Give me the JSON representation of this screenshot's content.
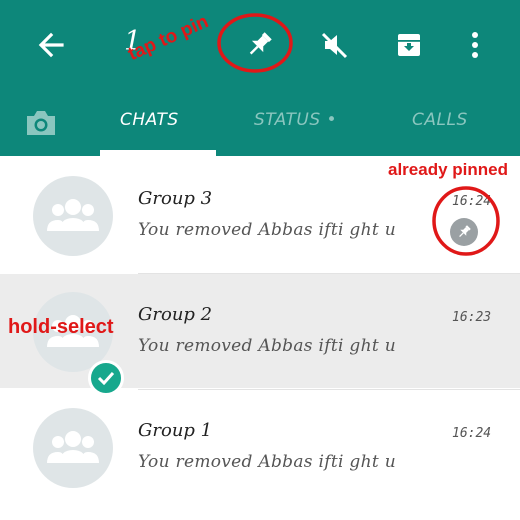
{
  "header": {
    "selected_count": "1",
    "icons": [
      "back-arrow-icon",
      "pin-icon",
      "mute-icon",
      "archive-icon",
      "more-vert-icon"
    ]
  },
  "tabs": [
    {
      "label": "CHATS",
      "active": true
    },
    {
      "label": "STATUS",
      "active": false
    },
    {
      "label": "CALLS",
      "active": false
    }
  ],
  "status_dot": "•",
  "chats": [
    {
      "name": "Group 3",
      "message": "You removed Abbas ifti ght u",
      "time": "16:24",
      "pinned": true,
      "selected": false
    },
    {
      "name": "Group 2",
      "message": "You removed Abbas ifti ght u",
      "time": "16:23",
      "pinned": false,
      "selected": true
    },
    {
      "name": "Group 1",
      "message": "You removed Abbas ifti ght u",
      "time": "16:24",
      "pinned": false,
      "selected": false
    }
  ],
  "annotations": {
    "tap_to_pin": "tap to pin",
    "already_pinned": "already pinned",
    "hold_select": "hold-select"
  },
  "colors": {
    "brand": "#0d877a",
    "annotation": "#e01818",
    "selection_check": "#17a88d"
  }
}
